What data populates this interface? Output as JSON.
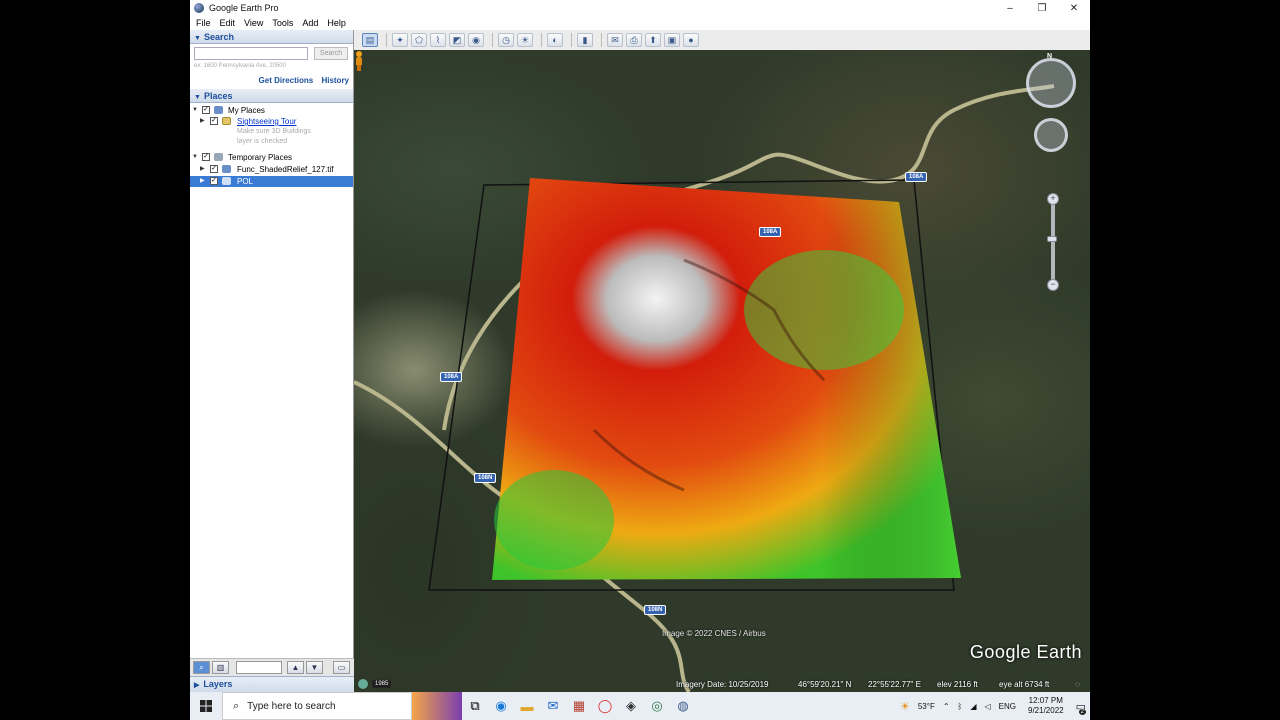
{
  "window": {
    "title": "Google Earth Pro",
    "controls": {
      "minimize": "–",
      "maximize": "❐",
      "close": "✕"
    }
  },
  "menu": [
    "File",
    "Edit",
    "View",
    "Tools",
    "Add",
    "Help"
  ],
  "search": {
    "header": "Search",
    "placeholder": "",
    "button": "Search",
    "hint": "ex: 1600 Pennsylvania Ave, 20500",
    "get_directions": "Get Directions",
    "history": "History"
  },
  "places": {
    "header": "Places",
    "my_places": "My Places",
    "sightseeing": "Sightseeing Tour",
    "sightseeing_desc": [
      "Make sure 3D Buildings",
      "layer is checked"
    ],
    "temporary": "Temporary Places",
    "shaded": "Func_ShadedRelief_127.tif",
    "pol": "POL"
  },
  "layers": {
    "header": "Layers"
  },
  "map": {
    "watermark": "Google Earth",
    "credit": "Image © 2022 CNES / Airbus",
    "year": "1985",
    "road_labels": [
      "108A",
      "108A",
      "108A",
      "108N",
      "108N"
    ],
    "status": {
      "imagery_date": "Imagery Date: 10/25/2019",
      "lat": "46°59'20.21\" N",
      "lon": "22°55'22.77\" E",
      "elev": "elev  2116 ft",
      "eye": "eye alt   6734 ft"
    },
    "nav": {
      "north": "N",
      "zoom_in": "+",
      "zoom_out": "−"
    }
  },
  "taskbar": {
    "search_placeholder": "Type here to search",
    "temp": "53°F",
    "lang": "ENG",
    "time": "12:07 PM",
    "date": "9/21/2022",
    "notif_count": "2"
  }
}
